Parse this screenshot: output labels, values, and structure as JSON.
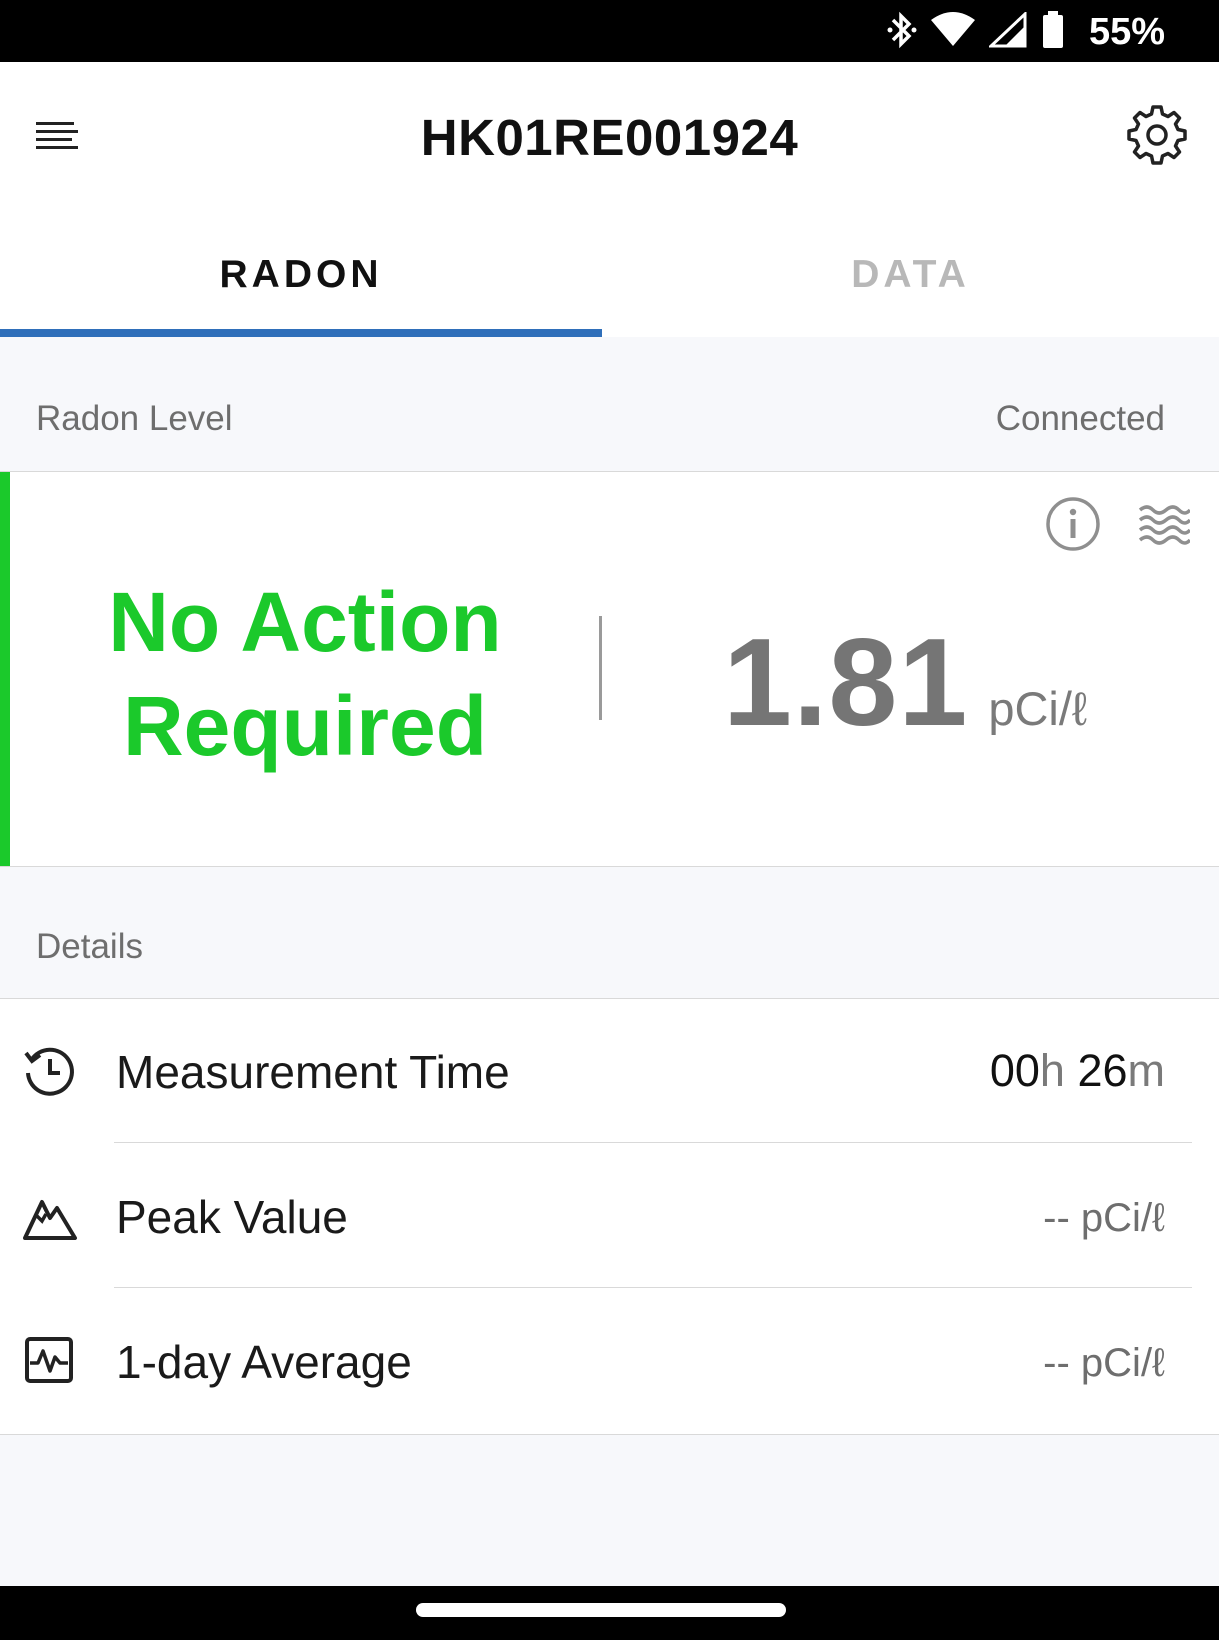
{
  "status_bar": {
    "battery_percent": "55%",
    "icons": [
      "bluetooth-icon",
      "wifi-icon",
      "cell-signal-icon",
      "battery-icon"
    ]
  },
  "app_bar": {
    "title": "HK01RE001924"
  },
  "tabs": [
    {
      "label": "RADON",
      "active": true
    },
    {
      "label": "DATA",
      "active": false
    }
  ],
  "radon_section": {
    "title": "Radon Level",
    "connection_status": "Connected"
  },
  "radon_card": {
    "status_line1": "No Action",
    "status_line2": "Required",
    "value": "1.81",
    "unit": "pCi/ℓ",
    "status_color": "#1bc92b"
  },
  "details_section": {
    "title": "Details"
  },
  "details": {
    "measurement_time": {
      "label": "Measurement Time",
      "hours": "00",
      "hours_unit": "h",
      "minutes": "26",
      "minutes_unit": "m"
    },
    "peak_value": {
      "label": "Peak Value",
      "value": "-- pCi/ℓ"
    },
    "one_day_average": {
      "label": "1-day Average",
      "value": "-- pCi/ℓ"
    }
  },
  "colors": {
    "accent_blue": "#2f6fba",
    "green": "#1bc92b"
  }
}
